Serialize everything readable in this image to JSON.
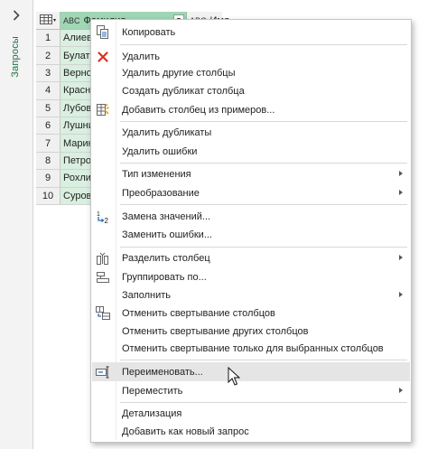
{
  "queries_pane": {
    "label": "Запросы"
  },
  "grid": {
    "columns": [
      {
        "type": "ABC",
        "name": "Фамилия"
      },
      {
        "type": "ABC",
        "name": "Имя"
      }
    ],
    "rows": [
      {
        "n": "1",
        "v": "Алиев"
      },
      {
        "n": "2",
        "v": "Булат"
      },
      {
        "n": "3",
        "v": "Верно"
      },
      {
        "n": "4",
        "v": "Красно"
      },
      {
        "n": "5",
        "v": "Лубов"
      },
      {
        "n": "6",
        "v": "Лушни"
      },
      {
        "n": "7",
        "v": "Марин"
      },
      {
        "n": "8",
        "v": "Петро"
      },
      {
        "n": "9",
        "v": "Рохли"
      },
      {
        "n": "10",
        "v": "Суров"
      }
    ]
  },
  "menu": {
    "copy": "Копировать",
    "remove": "Удалить",
    "remove_other": "Удалить другие столбцы",
    "duplicate": "Создать дубликат столбца",
    "add_from_examples": "Добавить столбец из примеров...",
    "remove_duplicates": "Удалить дубликаты",
    "remove_errors": "Удалить ошибки",
    "change_type": "Тип изменения",
    "transform": "Преобразование",
    "replace_values": "Замена значений...",
    "replace_errors": "Заменить ошибки...",
    "split_column": "Разделить столбец",
    "group_by": "Группировать по...",
    "fill": "Заполнить",
    "unpivot": "Отменить свертывание столбцов",
    "unpivot_other": "Отменить свертывание других столбцов",
    "unpivot_selected": "Отменить свертывание только для выбранных столбцов",
    "rename": "Переименовать...",
    "move": "Переместить",
    "drill_down": "Детализация",
    "add_as_new_query": "Добавить как новый запрос"
  },
  "colors": {
    "accent": "#217346",
    "selected_column": "#9fd6b4",
    "selected_cells": "#d9efe0",
    "highlight": "#e5e5e5"
  },
  "icons": [
    "chevron-right-icon",
    "table-icon",
    "copy-icon",
    "delete-icon",
    "column-from-examples-icon",
    "replace-values-icon",
    "split-column-icon",
    "group-by-icon",
    "unpivot-icon",
    "rename-icon",
    "mouse-cursor-icon"
  ]
}
